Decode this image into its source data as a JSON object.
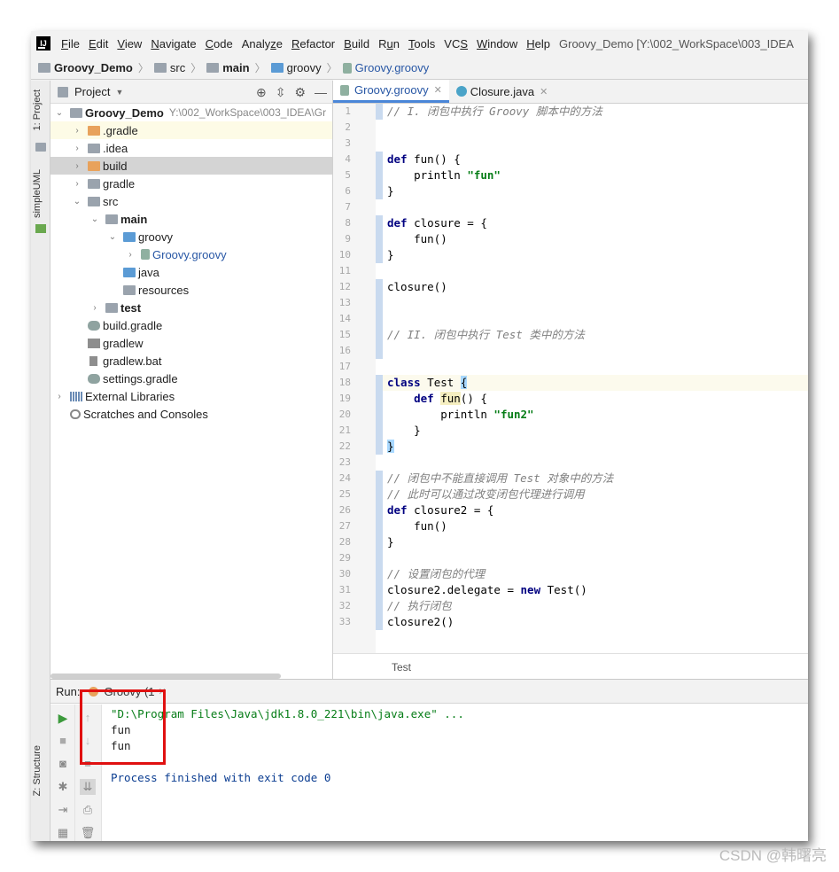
{
  "window_title": "Groovy_Demo [Y:\\002_WorkSpace\\003_IDEA",
  "app_logo": "IJ",
  "menu": [
    {
      "mn": "F",
      "rest": "ile"
    },
    {
      "mn": "E",
      "rest": "dit"
    },
    {
      "mn": "V",
      "rest": "iew"
    },
    {
      "mn": "N",
      "rest": "avigate"
    },
    {
      "mn": "C",
      "rest": "ode"
    },
    {
      "mn": "",
      "rest": "Analy",
      "tail": "z",
      "end": "e"
    },
    {
      "mn": "R",
      "rest": "efactor"
    },
    {
      "mn": "B",
      "rest": "uild"
    },
    {
      "mn": "",
      "rest": "R",
      "tail": "u",
      "end": "n"
    },
    {
      "mn": "T",
      "rest": "ools"
    },
    {
      "mn": "",
      "rest": "VC",
      "tail": "S",
      "end": ""
    },
    {
      "mn": "W",
      "rest": "indow"
    },
    {
      "mn": "H",
      "rest": "elp"
    }
  ],
  "breadcrumbs": [
    "Groovy_Demo",
    "src",
    "main",
    "groovy",
    "Groovy.groovy"
  ],
  "left_strip": {
    "project_tab": "1: Project",
    "uml_tab": "simpleUML",
    "structure_tab": "Z: Structure"
  },
  "project_panel": {
    "title": "Project",
    "root": {
      "name": "Groovy_Demo",
      "path": "Y:\\002_WorkSpace\\003_IDEA\\Gr"
    },
    "items": [
      {
        "label": ".gradle"
      },
      {
        "label": ".idea"
      },
      {
        "label": "build"
      },
      {
        "label": "gradle"
      },
      {
        "label": "src"
      },
      {
        "label": "main"
      },
      {
        "label": "groovy"
      },
      {
        "label": "Groovy.groovy"
      },
      {
        "label": "java"
      },
      {
        "label": "resources"
      },
      {
        "label": "test"
      },
      {
        "label": "build.gradle"
      },
      {
        "label": "gradlew"
      },
      {
        "label": "gradlew.bat"
      },
      {
        "label": "settings.gradle"
      },
      {
        "label": "External Libraries"
      },
      {
        "label": "Scratches and Consoles"
      }
    ]
  },
  "editor": {
    "tabs": [
      {
        "label": "Groovy.groovy",
        "active": true
      },
      {
        "label": "Closure.java",
        "active": false
      }
    ],
    "line_numbers": [
      "1",
      "2",
      "3",
      "4",
      "5",
      "6",
      "7",
      "8",
      "9",
      "10",
      "11",
      "12",
      "13",
      "14",
      "15",
      "16",
      "17",
      "18",
      "19",
      "20",
      "21",
      "22",
      "23",
      "24",
      "25",
      "26",
      "27",
      "28",
      "29",
      "30",
      "31",
      "32",
      "33"
    ],
    "code": {
      "l1": "// I. 闭包中执行 Groovy 脚本中的方法",
      "l4_kw": "def",
      "l4_rest": " fun() {",
      "l5_a": "    println ",
      "l5_str": "\"fun\"",
      "l6": "}",
      "l8_kw": "def",
      "l8_rest": " closure = {",
      "l9": "    fun()",
      "l10": "}",
      "l12": "closure()",
      "l15": "// II. 闭包中执行 Test 类中的方法",
      "l18_kw": "class",
      "l18_rest": " Test ",
      "l18_br": "{",
      "l19_pre": "    ",
      "l19_kw": "def",
      "l19_sp": " ",
      "l19_fn": "fun",
      "l19_rest": "() {",
      "l20_a": "        println ",
      "l20_str": "\"fun2\"",
      "l21": "    }",
      "l22": "}",
      "l24": "// 闭包中不能直接调用 Test 对象中的方法",
      "l25": "// 此时可以通过改变闭包代理进行调用",
      "l26_kw": "def",
      "l26_rest": " closure2 = {",
      "l27": "    fun()",
      "l28": "}",
      "l30": "// 设置闭包的代理",
      "l31_a": "closure2.delegate = ",
      "l31_kw": "new",
      "l31_b": " Test()",
      "l32": "// 执行闭包",
      "l33": "closure2()"
    },
    "breadcrumb": "Test"
  },
  "run_panel": {
    "label": "Run:",
    "tab": "Groovy (1",
    "console": [
      "\"D:\\Program Files\\Java\\jdk1.8.0_221\\bin\\java.exe\" ...",
      "fun",
      "fun",
      "",
      "Process finished with exit code 0"
    ]
  },
  "watermark": "CSDN @韩曙亮",
  "colors": {
    "accent": "#4a86d8",
    "highlight_box": "#e01010",
    "keyword": "#000080",
    "string": "#067d17",
    "comment": "#808080"
  }
}
